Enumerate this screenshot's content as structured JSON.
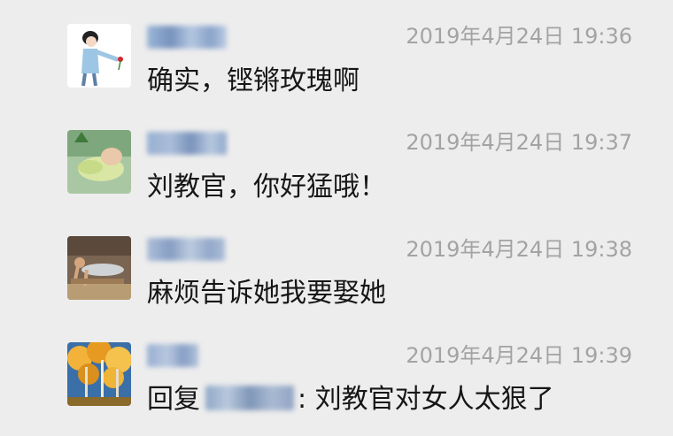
{
  "comments": [
    {
      "timestamp": "2019年4月24日 19:36",
      "message": "确实，铿锵玫瑰啊",
      "avatar_icon": "cartoon-boy-holding-rose-icon"
    },
    {
      "timestamp": "2019年4月24日 19:37",
      "message": "刘教官，你好猛哦！",
      "avatar_icon": "sleeping-baby-photo-icon"
    },
    {
      "timestamp": "2019年4月24日 19:38",
      "message": "麻烦告诉她我要娶她",
      "avatar_icon": "man-doing-pushup-photo-icon"
    },
    {
      "timestamp": "2019年4月24日 19:39",
      "message_prefix": "回复",
      "message_suffix": ": 刘教官对女人太狠了",
      "avatar_icon": "autumn-forest-photo-icon"
    }
  ],
  "colors": {
    "background": "#ededed",
    "timestamp": "#a3a3a3",
    "text": "#161616"
  }
}
